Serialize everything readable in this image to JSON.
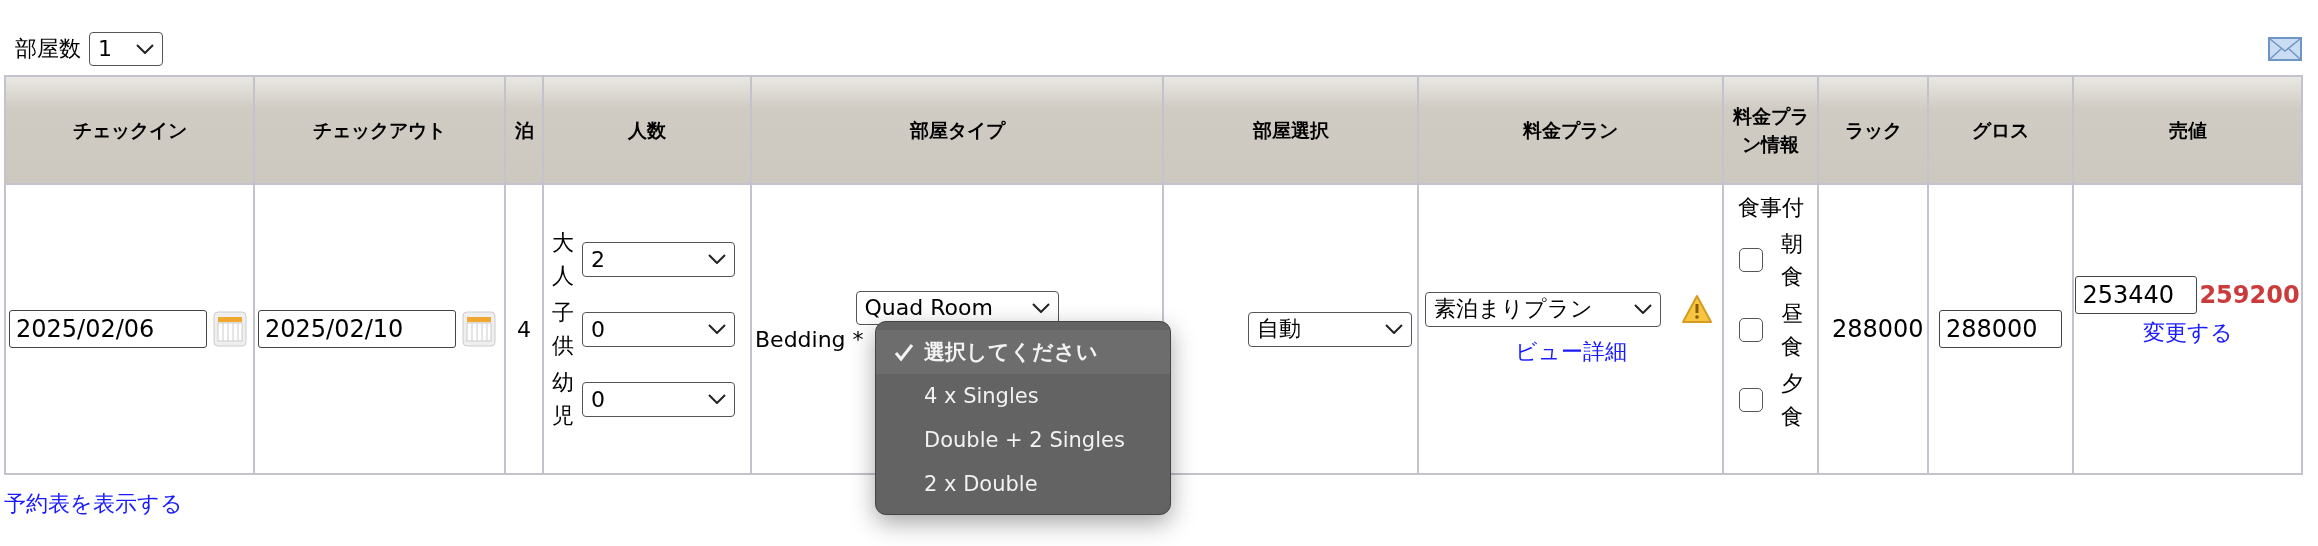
{
  "rooms": {
    "label": "部屋数",
    "value": "1"
  },
  "columns": [
    "チェックイン",
    "チェックアウト",
    "泊",
    "人数",
    "部屋タイプ",
    "部屋選択",
    "料金プラン",
    "料金プラン情報",
    "ラック",
    "グロス",
    "売値"
  ],
  "row": {
    "checkin": "2025/02/06",
    "checkout": "2025/02/10",
    "nights": "4",
    "guests": [
      {
        "label": "大人",
        "value": "2"
      },
      {
        "label": "子供",
        "value": "0"
      },
      {
        "label": "幼児",
        "value": "0"
      }
    ],
    "room_type": "Quad Room",
    "bedding": {
      "label": "Bedding *",
      "options": [
        {
          "label": "選択してください",
          "selected": true
        },
        {
          "label": "4 x Singles",
          "selected": false
        },
        {
          "label": "Double + 2 Singles",
          "selected": false
        },
        {
          "label": "2 x Double",
          "selected": false
        }
      ]
    },
    "room_select": "自動",
    "plan": {
      "value": "素泊まりプラン",
      "link": "ビュー詳細"
    },
    "meals": {
      "title": "食事付",
      "items": [
        {
          "label": "朝食",
          "checked": false
        },
        {
          "label": "昼食",
          "checked": false
        },
        {
          "label": "夕食",
          "checked": false
        }
      ]
    },
    "rack": "288000",
    "gross": "288000",
    "sale": {
      "value": "253440",
      "price": "259200",
      "link": "変更する"
    }
  },
  "footer_link": "予約表を表示する"
}
